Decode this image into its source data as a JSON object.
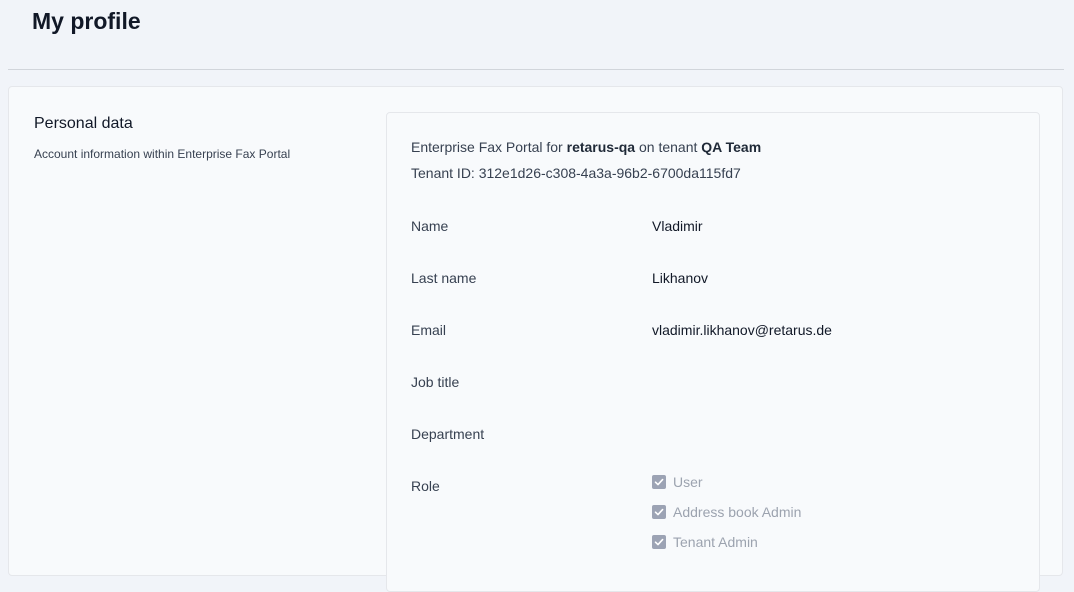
{
  "header": {
    "title": "My profile"
  },
  "personal_data": {
    "title": "Personal data",
    "description": "Account information within Enterprise Fax Portal",
    "intro": {
      "prefix": "Enterprise Fax Portal for ",
      "account": "retarus-qa",
      "middle": " on tenant ",
      "tenant_name": "QA Team"
    },
    "tenant_id_label": "Tenant ID: ",
    "tenant_id": "312e1d26-c308-4a3a-96b2-6700da115fd7",
    "fields": {
      "name_label": "Name",
      "name_value": "Vladimir",
      "last_name_label": "Last name",
      "last_name_value": "Likhanov",
      "email_label": "Email",
      "email_value": "vladimir.likhanov@retarus.de",
      "job_title_label": "Job title",
      "job_title_value": "",
      "department_label": "Department",
      "department_value": "",
      "role_label": "Role"
    },
    "roles": [
      {
        "label": "User",
        "checked": true
      },
      {
        "label": "Address book Admin",
        "checked": true
      },
      {
        "label": "Tenant Admin",
        "checked": true
      }
    ]
  }
}
